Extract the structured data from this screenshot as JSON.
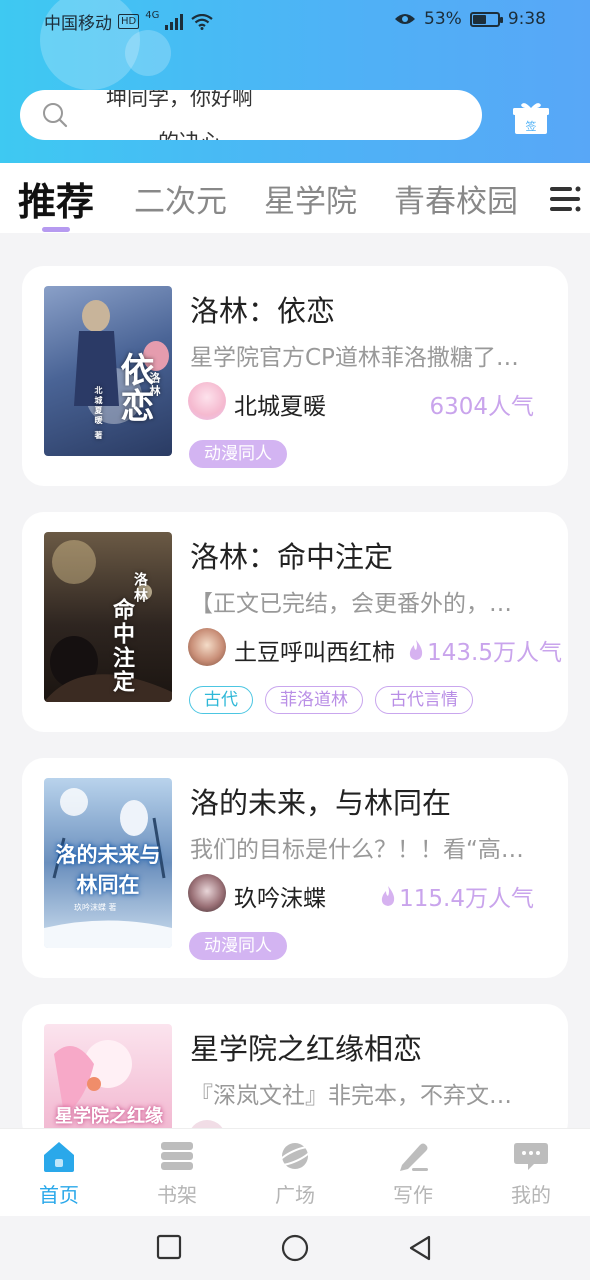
{
  "status_bar": {
    "carrier": "中国移动",
    "hd": "HD",
    "network": "4G",
    "battery_percent": "53%",
    "battery_level": 0.53,
    "time": "9:38"
  },
  "search": {
    "line1": "坤同学，你好啊",
    "line2": "的决心"
  },
  "checkin_label": "签",
  "tabs": [
    {
      "label": "推荐",
      "active": true
    },
    {
      "label": "二次元",
      "active": false
    },
    {
      "label": "星学院",
      "active": false
    },
    {
      "label": "青春校园",
      "active": false
    }
  ],
  "books": [
    {
      "title": "洛林：依恋",
      "description": "星学院官方CP道林菲洛撒糖了…",
      "author": "北城夏暖",
      "popularity": "6304人气",
      "hot": false,
      "tags": [
        {
          "label": "动漫同人",
          "style": "filled"
        }
      ],
      "cover_text": "依恋",
      "cover_small": "洛林",
      "cover_sub": "北城夏暖 著"
    },
    {
      "title": "洛林：命中注定",
      "description": "【正文已完结，会更番外的，…",
      "author": "土豆呼叫西红柿",
      "popularity": "143.5万人气",
      "hot": true,
      "tags": [
        {
          "label": "古代",
          "style": "cyan"
        },
        {
          "label": "菲洛道林",
          "style": "purple"
        },
        {
          "label": "古代言情",
          "style": "purple"
        }
      ],
      "cover_text": "命中注定",
      "cover_small": "洛林"
    },
    {
      "title": "洛的未来，与林同在",
      "description": "我们的目标是什么？！！看“高…",
      "author": "玖吟沫蝶",
      "popularity": "115.4万人气",
      "hot": true,
      "tags": [
        {
          "label": "动漫同人",
          "style": "filled"
        }
      ],
      "cover_text": "洛的未来与林同在",
      "cover_sub": "玖吟沫蝶 著"
    },
    {
      "title": "星学院之红缘相恋",
      "description": "『深岚文社』非完本，不弃文…",
      "cover_text": "星学院之红缘相恋"
    }
  ],
  "bottom_nav": [
    {
      "label": "首页",
      "icon": "home-icon",
      "active": true
    },
    {
      "label": "书架",
      "icon": "bookshelf-icon",
      "active": false
    },
    {
      "label": "广场",
      "icon": "planet-icon",
      "active": false
    },
    {
      "label": "写作",
      "icon": "pen-icon",
      "active": false
    },
    {
      "label": "我的",
      "icon": "chat-bubble-icon",
      "active": false
    }
  ],
  "colors": {
    "header_gradient_start": "#3ec9f2",
    "header_gradient_end": "#58a7f7",
    "accent_blue": "#2aa8ea",
    "tag_purple": "#d3b4f2",
    "popularity_purple": "#c9a4ec"
  }
}
